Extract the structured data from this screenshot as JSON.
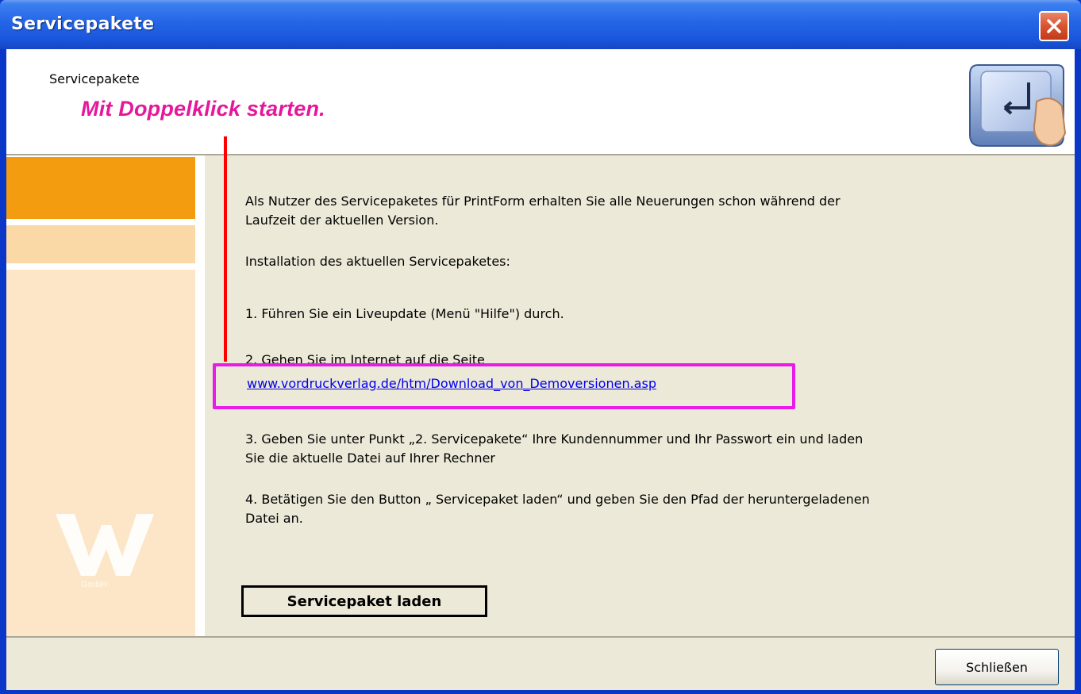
{
  "window": {
    "title": "Servicepakete",
    "close_icon": "close-icon"
  },
  "header": {
    "title": "Servicepakete",
    "annotation": "Mit Doppelklick starten.",
    "graphic_icon": "enter-key-icon"
  },
  "sidebar": {
    "logo_icon": "w-logo-icon",
    "logo_sub": "GmbH"
  },
  "content": {
    "intro": "Als Nutzer des Servicepaketes für PrintForm erhalten Sie alle Neuerungen schon während der\nLaufzeit der aktuellen Version.",
    "install": "Installation des aktuellen Servicepaketes:",
    "step1": "1. Führen Sie ein Liveupdate (Menü \"Hilfe\") durch.",
    "step2": "2. Gehen Sie im Internet auf die Seite",
    "link": "www.vordruckverlag.de/htm/Download_von_Demoversionen.asp",
    "step3": "3. Geben Sie unter Punkt „2. Servicepakete“ Ihre Kundennummer und Ihr Passwort ein und laden\nSie die aktuelle Datei auf Ihrer Rechner",
    "step4": "4. Betätigen Sie den Button „ Servicepaket laden“ und geben Sie den Pfad der heruntergeladenen\nDatei an."
  },
  "buttons": {
    "load": "Servicepaket laden",
    "close": "Schließen"
  },
  "colors": {
    "title_bar": "#2465e6",
    "annotation": "#e5179a",
    "highlight_box": "#e81be8",
    "pointer_line": "#ff0000",
    "sidebar_orange": "#f39c10",
    "link": "#0000ee"
  }
}
